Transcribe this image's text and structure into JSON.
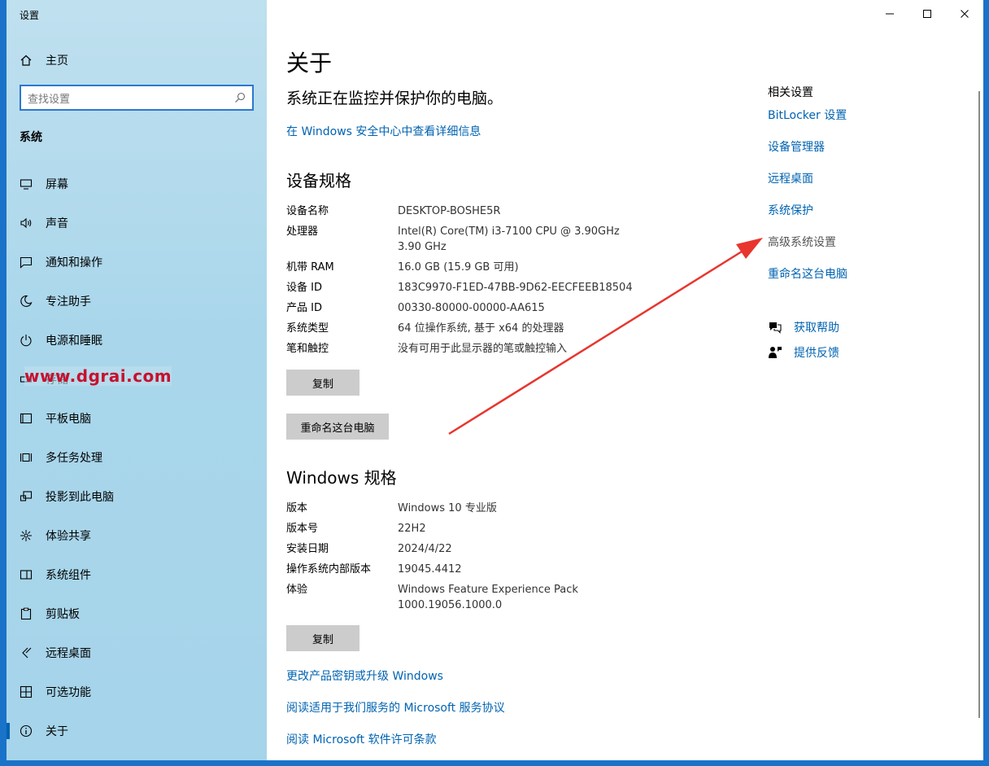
{
  "window": {
    "title": "设置",
    "minimize_icon": "minimize-icon",
    "maximize_icon": "maximize-icon",
    "close_icon": "close-icon"
  },
  "sidebar": {
    "home_label": "主页",
    "search_placeholder": "查找设置",
    "section": "系统",
    "items": [
      {
        "label": "屏幕",
        "icon": "monitor-icon"
      },
      {
        "label": "声音",
        "icon": "speaker-icon"
      },
      {
        "label": "通知和操作",
        "icon": "notification-icon"
      },
      {
        "label": "专注助手",
        "icon": "moon-icon"
      },
      {
        "label": "电源和睡眠",
        "icon": "power-icon"
      },
      {
        "label": "存储",
        "icon": "storage-icon"
      },
      {
        "label": "平板电脑",
        "icon": "tablet-icon"
      },
      {
        "label": "多任务处理",
        "icon": "multitask-icon"
      },
      {
        "label": "投影到此电脑",
        "icon": "project-icon"
      },
      {
        "label": "体验共享",
        "icon": "share-icon"
      },
      {
        "label": "系统组件",
        "icon": "components-icon"
      },
      {
        "label": "剪贴板",
        "icon": "clipboard-icon"
      },
      {
        "label": "远程桌面",
        "icon": "remote-icon"
      },
      {
        "label": "可选功能",
        "icon": "optional-icon"
      },
      {
        "label": "关于",
        "icon": "info-icon"
      }
    ],
    "watermark": "www.dgrai.com"
  },
  "main": {
    "title": "关于",
    "status": "系统正在监控并保护你的电脑。",
    "security_link": "在 Windows 安全中心中查看详细信息",
    "device_specs": {
      "heading": "设备规格",
      "rows": [
        {
          "k": "设备名称",
          "v": "DESKTOP-BOSHE5R"
        },
        {
          "k": "处理器",
          "v": "Intel(R) Core(TM) i3-7100 CPU @ 3.90GHz   3.90 GHz"
        },
        {
          "k": "机带 RAM",
          "v": "16.0 GB (15.9 GB 可用)"
        },
        {
          "k": "设备 ID",
          "v": "183C9970-F1ED-47BB-9D62-EECFEEB18504"
        },
        {
          "k": "产品 ID",
          "v": "00330-80000-00000-AA615"
        },
        {
          "k": "系统类型",
          "v": "64 位操作系统, 基于 x64 的处理器"
        },
        {
          "k": "笔和触控",
          "v": "没有可用于此显示器的笔或触控输入"
        }
      ],
      "copy_label": "复制",
      "rename_label": "重命名这台电脑"
    },
    "windows_specs": {
      "heading": "Windows 规格",
      "rows": [
        {
          "k": "版本",
          "v": "Windows 10 专业版"
        },
        {
          "k": "版本号",
          "v": "22H2"
        },
        {
          "k": "安装日期",
          "v": "2024/4/22"
        },
        {
          "k": "操作系统内部版本",
          "v": "19045.4412"
        },
        {
          "k": "体验",
          "v": "Windows Feature Experience Pack 1000.19056.1000.0"
        }
      ],
      "copy_label": "复制"
    },
    "links": [
      "更改产品密钥或升级 Windows",
      "阅读适用于我们服务的 Microsoft 服务协议",
      "阅读 Microsoft 软件许可条款"
    ]
  },
  "related": {
    "title": "相关设置",
    "links": [
      "BitLocker 设置",
      "设备管理器",
      "远程桌面",
      "系统保护",
      "高级系统设置",
      "重命名这台电脑"
    ],
    "help": "获取帮助",
    "feedback": "提供反馈"
  },
  "colors": {
    "accent": "#0063b1",
    "annotation_arrow": "#e8352e"
  }
}
